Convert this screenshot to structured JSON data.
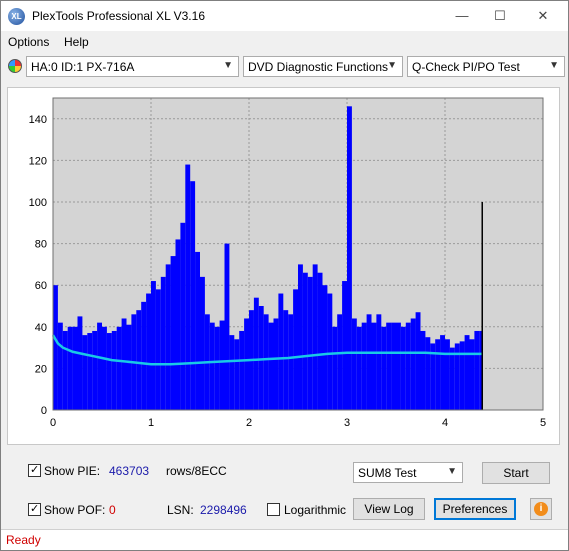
{
  "window": {
    "title": "PlexTools Professional XL V3.16",
    "icon_text": "XL",
    "controls": {
      "minimize": "—",
      "maximize": "☐",
      "close": "✕"
    }
  },
  "menu": {
    "items": [
      "Options",
      "Help"
    ]
  },
  "toolbar": {
    "drive": "HA:0 ID:1  PX-716A",
    "function": "DVD Diagnostic Functions",
    "test": "Q-Check PI/PO Test"
  },
  "chart_data": {
    "type": "bar",
    "title": "",
    "xlabel": "",
    "ylabel": "",
    "xlim": [
      0,
      5
    ],
    "ylim": [
      0,
      150
    ],
    "x_ticks": [
      0,
      1,
      2,
      3,
      4,
      5
    ],
    "y_ticks": [
      0,
      20,
      40,
      60,
      80,
      100,
      120,
      140
    ],
    "grid": true,
    "data_end_x": 4.38,
    "end_marker_value": 100,
    "colors": {
      "plot_bg": "#d4d4d4",
      "bars": "#0000ff",
      "line": "#19c9e6",
      "marker": "#000000",
      "outer_bg": "#ffffff"
    },
    "series": [
      {
        "kind": "bars",
        "x": [
          0.0,
          0.05,
          0.1,
          0.15,
          0.2,
          0.25,
          0.3,
          0.35,
          0.4,
          0.45,
          0.5,
          0.55,
          0.6,
          0.65,
          0.7,
          0.75,
          0.8,
          0.85,
          0.9,
          0.95,
          1.0,
          1.05,
          1.1,
          1.15,
          1.2,
          1.25,
          1.3,
          1.35,
          1.4,
          1.45,
          1.5,
          1.55,
          1.6,
          1.65,
          1.7,
          1.75,
          1.8,
          1.85,
          1.9,
          1.95,
          2.0,
          2.05,
          2.1,
          2.15,
          2.2,
          2.25,
          2.3,
          2.35,
          2.4,
          2.45,
          2.5,
          2.55,
          2.6,
          2.65,
          2.7,
          2.75,
          2.8,
          2.85,
          2.9,
          2.95,
          3.0,
          3.05,
          3.1,
          3.15,
          3.2,
          3.25,
          3.3,
          3.35,
          3.4,
          3.45,
          3.5,
          3.55,
          3.6,
          3.65,
          3.7,
          3.75,
          3.8,
          3.85,
          3.9,
          3.95,
          4.0,
          4.05,
          4.1,
          4.15,
          4.2,
          4.25,
          4.3,
          4.35
        ],
        "values": [
          60,
          42,
          38,
          40,
          40,
          45,
          36,
          37,
          38,
          42,
          40,
          37,
          38,
          40,
          44,
          41,
          46,
          48,
          52,
          56,
          62,
          58,
          64,
          70,
          74,
          82,
          90,
          118,
          110,
          76,
          64,
          46,
          42,
          40,
          43,
          80,
          36,
          34,
          38,
          44,
          48,
          54,
          50,
          46,
          42,
          44,
          56,
          48,
          46,
          58,
          70,
          66,
          64,
          70,
          66,
          60,
          56,
          40,
          46,
          62,
          146,
          44,
          40,
          42,
          46,
          42,
          46,
          40,
          42,
          42,
          42,
          40,
          42,
          44,
          47,
          38,
          35,
          32,
          34,
          36,
          34,
          30,
          32,
          33,
          36,
          34,
          38,
          38
        ]
      },
      {
        "kind": "line",
        "x": [
          0.0,
          0.05,
          0.1,
          0.2,
          0.3,
          0.4,
          0.5,
          0.6,
          0.8,
          1.0,
          1.2,
          1.4,
          1.6,
          1.8,
          2.0,
          2.2,
          2.4,
          2.6,
          2.8,
          3.0,
          3.2,
          3.4,
          3.6,
          3.8,
          4.0,
          4.2,
          4.38
        ],
        "values": [
          36,
          32,
          30,
          28,
          27,
          26,
          25,
          24,
          23,
          22,
          22,
          22.5,
          23,
          23.5,
          24,
          24.5,
          25,
          26,
          27,
          27.5,
          27.5,
          27.5,
          27.5,
          27.5,
          27,
          27,
          27
        ]
      }
    ]
  },
  "options": {
    "show_pie": {
      "label": "Show PIE:",
      "checked": "✓",
      "value": "463703",
      "unit": "rows/8ECC"
    },
    "show_pof": {
      "label": "Show POF:",
      "checked": "✓",
      "value": "0"
    },
    "lsn": {
      "label": "LSN:",
      "value": "2298496"
    },
    "logarithmic": {
      "label": "Logarithmic"
    },
    "test_select": "SUM8 Test",
    "buttons": {
      "start": "Start",
      "view_log": "View Log",
      "preferences": "Preferences",
      "info": "i"
    }
  },
  "status": {
    "text": "Ready"
  }
}
